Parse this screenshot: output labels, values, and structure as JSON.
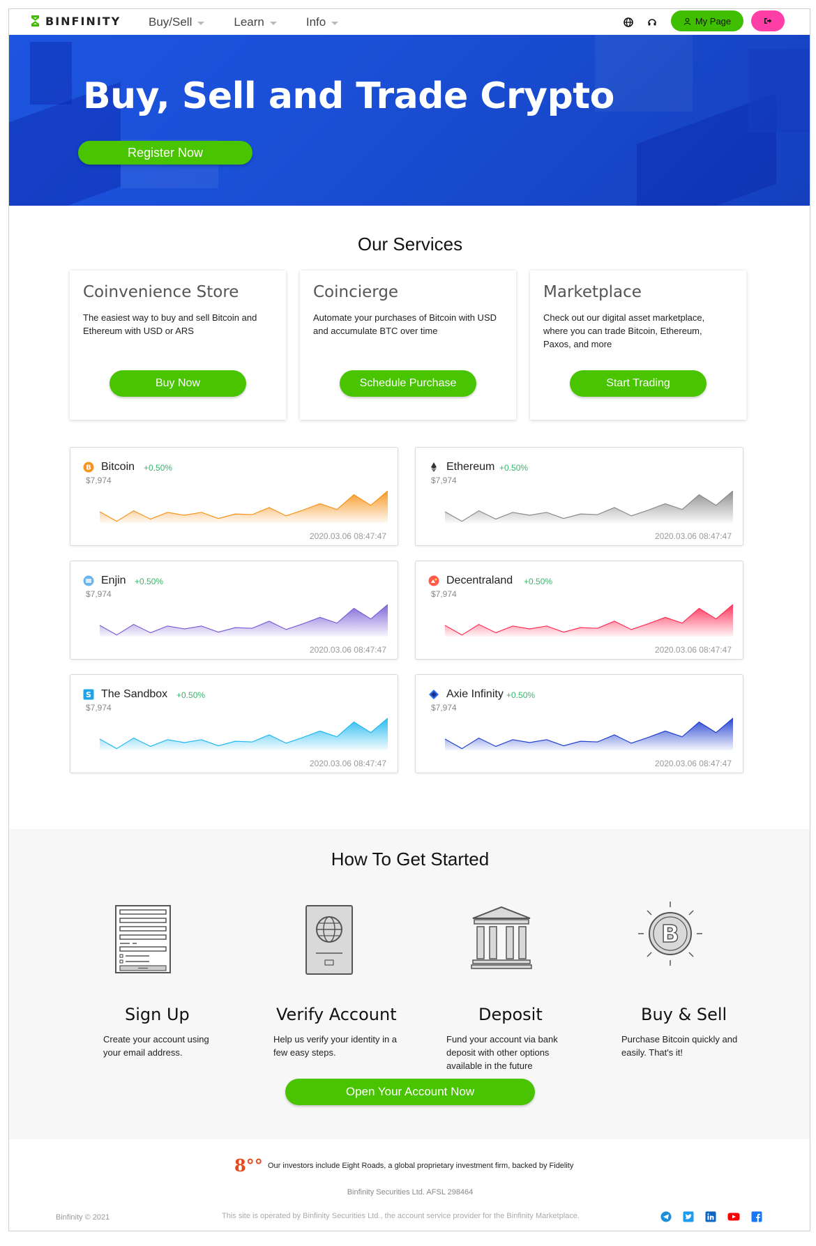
{
  "header": {
    "brand": "BINFINITY",
    "nav": [
      {
        "label": "Buy/Sell"
      },
      {
        "label": "Learn"
      },
      {
        "label": "Info"
      }
    ],
    "my_page_label": "My Page"
  },
  "hero": {
    "title": "Buy, Sell and Trade Crypto",
    "register_label": "Register Now"
  },
  "services": {
    "title": "Our Services",
    "cards": [
      {
        "title": "Coinvenience Store",
        "desc": "The easiest way to buy and sell Bitcoin and Ethereum with USD or ARS",
        "button": "Buy Now"
      },
      {
        "title": "Coincierge",
        "desc": "Automate your purchases of Bitcoin with USD and accumulate BTC over time",
        "button": "Schedule Purchase"
      },
      {
        "title": "Marketplace",
        "desc": "Check out our digital asset marketplace, where you can trade Bitcoin, Ethereum, Paxos, and more",
        "button": "Start Trading"
      }
    ]
  },
  "coins": [
    {
      "name": "Bitcoin",
      "change": "+0.50%",
      "price": "$7,974",
      "time": "2020.03.06 08:47:47",
      "color": "#f7931a",
      "icon": "bitcoin-icon"
    },
    {
      "name": "Ethereum",
      "change": "+0.50%",
      "price": "$7,974",
      "time": "2020.03.06 08:47:47",
      "color": "#8a8a8a",
      "icon": "ethereum-icon"
    },
    {
      "name": "Enjin",
      "change": "+0.50%",
      "price": "$7,974",
      "time": "2020.03.06 08:47:47",
      "color": "#7b5fd6",
      "icon": "enjin-icon"
    },
    {
      "name": "Decentraland",
      "change": "+0.50%",
      "price": "$7,974",
      "time": "2020.03.06 08:47:47",
      "color": "#ff2d55",
      "icon": "decentraland-icon"
    },
    {
      "name": "The Sandbox",
      "change": "+0.50%",
      "price": "$7,974",
      "time": "2020.03.06 08:47:47",
      "color": "#1fb8f0",
      "icon": "sandbox-icon"
    },
    {
      "name": "Axie Infinity",
      "change": "+0.50%",
      "price": "$7,974",
      "time": "2020.03.06 08:47:47",
      "color": "#1f3fd0",
      "icon": "axie-icon"
    }
  ],
  "sparkline": [
    0.35,
    0.05,
    0.38,
    0.12,
    0.33,
    0.24,
    0.33,
    0.14,
    0.28,
    0.26,
    0.48,
    0.22,
    0.4,
    0.6,
    0.42,
    0.88,
    0.55,
    1.0
  ],
  "howto": {
    "title": "How To Get Started",
    "steps": [
      {
        "title": "Sign Up",
        "desc": "Create your account using your email address."
      },
      {
        "title": "Verify Account",
        "desc": "Help us verify your identity in a few easy steps."
      },
      {
        "title": "Deposit",
        "desc": "Fund your account via bank deposit with other options available in the future"
      },
      {
        "title": "Buy & Sell",
        "desc": "Purchase Bitcoin quickly and easily. That's it!"
      }
    ],
    "cta": "Open Your Account Now"
  },
  "footer": {
    "investor_logo": "8°°",
    "investors": "Our investors include Eight Roads, a global proprietary investment firm, backed by Fidelity",
    "afsl": "Binfinity Securities Ltd. AFSL 298464",
    "copyright": "Binfinity © 2021",
    "operated": "This site is operated by Binfinity Securities Ltd., the account service provider for the Binfinity Marketplace."
  }
}
